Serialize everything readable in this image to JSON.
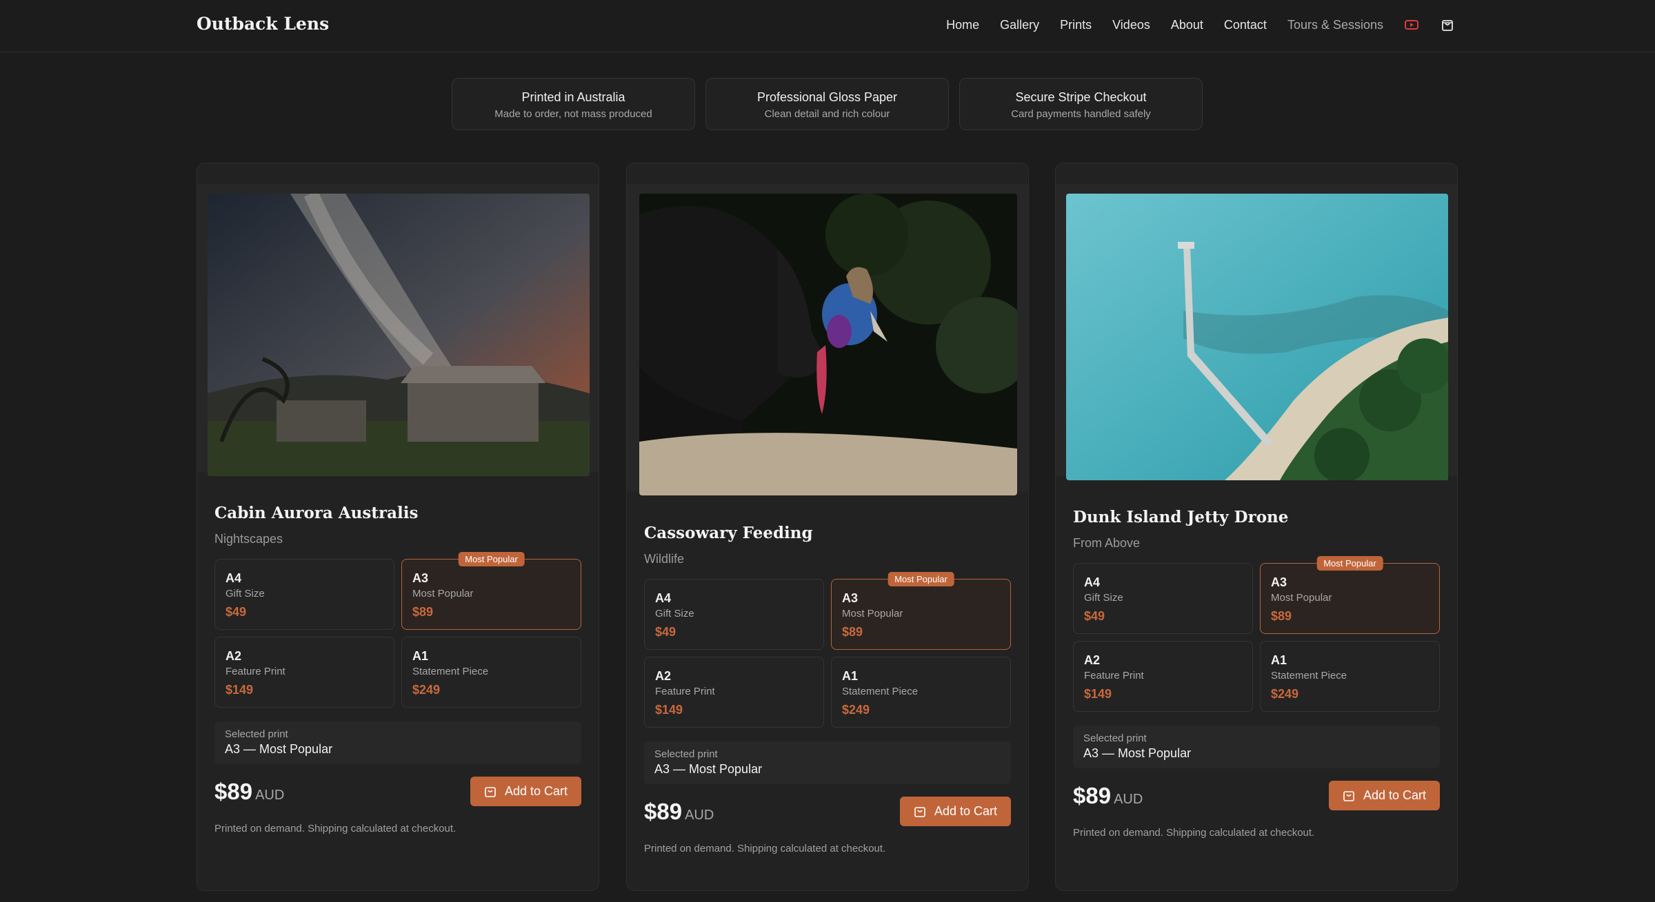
{
  "header": {
    "brand": "Outback Lens",
    "nav": [
      "Home",
      "Gallery",
      "Prints",
      "Videos",
      "About",
      "Contact",
      "Tours & Sessions"
    ],
    "youtube_icon": "youtube-icon",
    "cart_icon": "shopping-bag-icon"
  },
  "features": [
    {
      "title": "Printed in Australia",
      "sub": "Made to order, not mass produced"
    },
    {
      "title": "Professional Gloss Paper",
      "sub": "Clean detail and rich colour"
    },
    {
      "title": "Secure Stripe Checkout",
      "sub": "Card payments handled safely"
    }
  ],
  "badge_label": "Most Popular",
  "selected_label": "Selected print",
  "currency": "AUD",
  "add_label": "Add to Cart",
  "note": "Printed on demand. Shipping calculated at checkout.",
  "products": [
    {
      "title": "Cabin Aurora Australis",
      "category": "Nightscapes",
      "options": [
        {
          "size": "A4",
          "name": "Gift Size",
          "price": "$49"
        },
        {
          "size": "A3",
          "name": "Most Popular",
          "price": "$89"
        },
        {
          "size": "A2",
          "name": "Feature Print",
          "price": "$149"
        },
        {
          "size": "A1",
          "name": "Statement Piece",
          "price": "$249"
        }
      ],
      "selected": "A3 — Most Popular",
      "price": "$89"
    },
    {
      "title": "Cassowary Feeding",
      "category": "Wildlife",
      "options": [
        {
          "size": "A4",
          "name": "Gift Size",
          "price": "$49"
        },
        {
          "size": "A3",
          "name": "Most Popular",
          "price": "$89"
        },
        {
          "size": "A2",
          "name": "Feature Print",
          "price": "$149"
        },
        {
          "size": "A1",
          "name": "Statement Piece",
          "price": "$249"
        }
      ],
      "selected": "A3 — Most Popular",
      "price": "$89"
    },
    {
      "title": "Dunk Island Jetty Drone",
      "category": "From Above",
      "options": [
        {
          "size": "A4",
          "name": "Gift Size",
          "price": "$49"
        },
        {
          "size": "A3",
          "name": "Most Popular",
          "price": "$89"
        },
        {
          "size": "A2",
          "name": "Feature Print",
          "price": "$149"
        },
        {
          "size": "A1",
          "name": "Statement Piece",
          "price": "$249"
        }
      ],
      "selected": "A3 — Most Popular",
      "price": "$89"
    }
  ],
  "colors": {
    "accent": "#c0653a",
    "background": "#1c1c1c",
    "card": "#222222"
  }
}
